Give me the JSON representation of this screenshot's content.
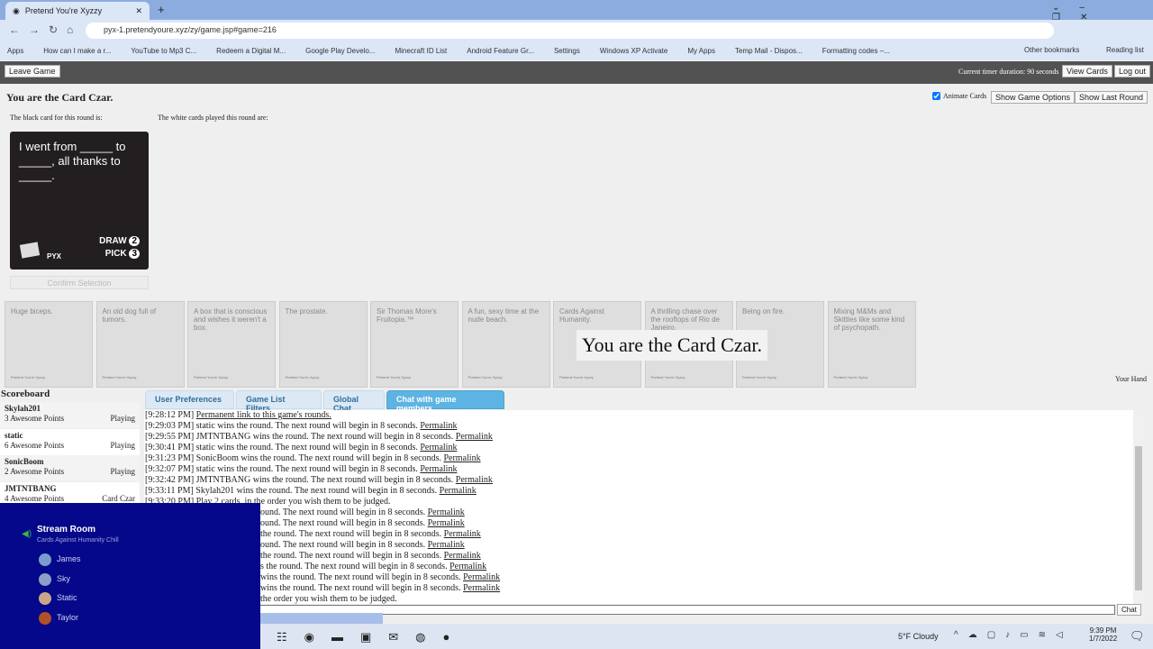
{
  "browser": {
    "tab_title": "Pretend You're Xyzzy",
    "url": "pyx-1.pretendyoure.xyz/zy/game.jsp#game=216",
    "bookmarks": [
      "Apps",
      "How can I make a r...",
      "YouTube to Mp3 C...",
      "Redeem a Digital M...",
      "Google Play Develo...",
      "Minecraft ID List",
      "Android Feature Gr...",
      "Settings",
      "Windows XP Activate",
      "My Apps",
      "Temp Mail - Dispos...",
      "Formatting codes –..."
    ],
    "other_bookmarks": "Other bookmarks",
    "reading_list": "Reading list"
  },
  "topbar": {
    "leave": "Leave Game",
    "timer": "Current timer duration: 90 seconds",
    "view_cards": "View Cards",
    "logout": "Log out"
  },
  "game": {
    "heading": "You are the Card Czar.",
    "animate": "Animate Cards",
    "animate_checked": true,
    "show_options": "Show Game Options",
    "show_last": "Show Last Round",
    "black_label": "The black card for this round is:",
    "white_label": "The white cards played this round are:",
    "black_card": {
      "text": "I went from _____ to _____, all thanks to _____.",
      "draw_label": "DRAW",
      "draw": "2",
      "pick_label": "PICK",
      "pick": "3",
      "logo": "PYX"
    },
    "confirm": "Confirm Selection",
    "czar_banner": "You are the Card Czar.",
    "your_hand": "Your Hand",
    "card_footer": "Pretend You're Xyzzy",
    "hand": [
      "Huge biceps.",
      "An old dog full of tumors.",
      "A box that is conscious and wishes it weren't a box.",
      "The prostate.",
      "Sir Thomas More's Fruitopia.™",
      "A fun, sexy time at the nude beach.",
      "Cards Against Humanity.",
      "A thrilling chase over the rooftops of Rio de Janeiro.",
      "Being on fire.",
      "Mixing M&Ms and Skittles like some kind of psychopath."
    ]
  },
  "scoreboard": {
    "title": "Scoreboard",
    "players": [
      {
        "name": "Skylah201",
        "points": "3 Awesome Points",
        "status": "Playing"
      },
      {
        "name": "static",
        "points": "6 Awesome Points",
        "status": "Playing"
      },
      {
        "name": "SonicBoom",
        "points": "2 Awesome Points",
        "status": "Playing"
      },
      {
        "name": "JMTNTBANG",
        "points": "4 Awesome Points",
        "status": "Card Czar"
      }
    ]
  },
  "tabs": [
    "User Preferences",
    "Game List Filters",
    "Global Chat",
    "Chat with game members"
  ],
  "chat": {
    "permalink": "Permalink",
    "send": "Chat",
    "lines": [
      {
        "text": "[9:28:12 PM] ",
        "link": "Permanent link to this game's rounds."
      },
      {
        "text": "[9:29:03 PM] static wins the round. The next round will begin in 8 seconds. ",
        "link": "Permalink"
      },
      {
        "text": "[9:29:55 PM] JMTNTBANG wins the round. The next round will begin in 8 seconds. ",
        "link": "Permalink"
      },
      {
        "text": "[9:30:41 PM] static wins the round. The next round will begin in 8 seconds. ",
        "link": "Permalink"
      },
      {
        "text": "[9:31:23 PM] SonicBoom wins the round. The next round will begin in 8 seconds. ",
        "link": "Permalink"
      },
      {
        "text": "[9:32:07 PM] static wins the round. The next round will begin in 8 seconds. ",
        "link": "Permalink"
      },
      {
        "text": "[9:32:42 PM] JMTNTBANG wins the round. The next round will begin in 8 seconds. ",
        "link": "Permalink"
      },
      {
        "text": "[9:33:11 PM] Skylah201 wins the round. The next round will begin in 8 seconds. ",
        "link": "Permalink"
      },
      {
        "text": "[9:33:20 PM] Play 2 cards, in the order you wish them to be judged.",
        "link": ""
      }
    ],
    "partial_lines": [
      {
        "text": "ound. The next round will begin in 8 seconds. ",
        "link": "Permalink"
      },
      {
        "text": "ound. The next round will begin in 8 seconds. ",
        "link": "Permalink"
      },
      {
        "text": " the round. The next round will begin in 8 seconds. ",
        "link": "Permalink"
      },
      {
        "text": "ound. The next round will begin in 8 seconds. ",
        "link": "Permalink"
      },
      {
        "text": " the round. The next round will begin in 8 seconds. ",
        "link": "Permalink"
      },
      {
        "text": "s the round. The next round will begin in 8 seconds. ",
        "link": "Permalink"
      },
      {
        "text": "wins the round. The next round will begin in 8 seconds. ",
        "link": "Permalink"
      },
      {
        "text": "wins the round. The next round will begin in 8 seconds. ",
        "link": "Permalink"
      },
      {
        "text": "the order you wish them to be judged.",
        "link": ""
      }
    ]
  },
  "voice": {
    "room": "Stream Room",
    "subtitle": "Cards Against Humanity Chill",
    "members": [
      "James",
      "Sky",
      "Static",
      "Taylor"
    ]
  },
  "taskbar": {
    "weather": "5°F  Cloudy",
    "time": "9:39 PM",
    "date": "1/7/2022"
  }
}
